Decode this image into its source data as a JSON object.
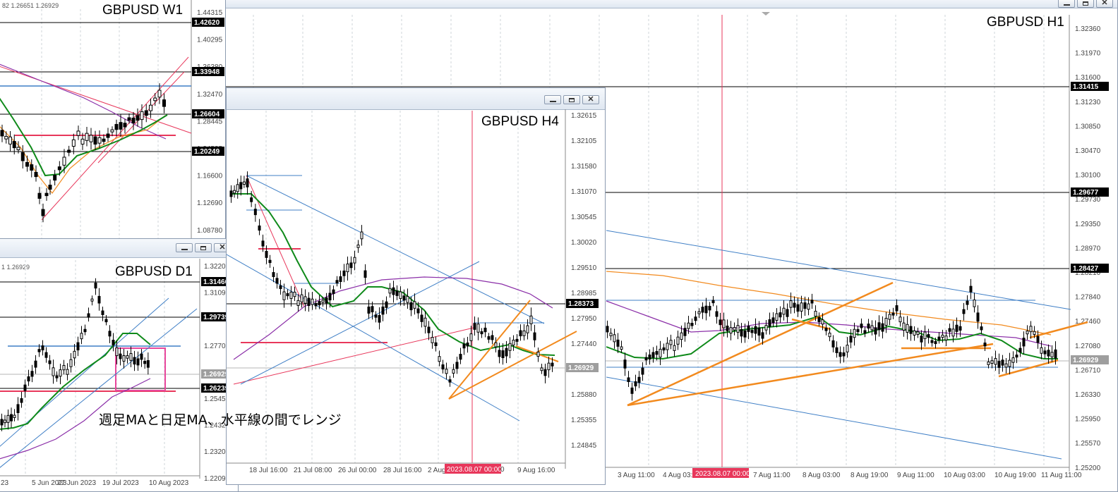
{
  "windows": {
    "h1": {
      "symbol_label": "GBPUSD H1",
      "price_scale": [
        "1.32360",
        "1.31970",
        "1.31600",
        "1.31230",
        "1.30850",
        "1.30470",
        "1.30100",
        "1.29730",
        "1.29350",
        "1.28970",
        "1.28210",
        "1.27840",
        "1.27460",
        "1.27080",
        "1.26710",
        "1.26330",
        "1.25950",
        "1.25570",
        "1.25200"
      ],
      "levels": [
        "1.31415",
        "1.29677",
        "1.28427",
        "1.26929"
      ],
      "time_axis": [
        "3 Aug 11:00",
        "4 Aug 03:00",
        "7 Aug 11:00",
        "8 Aug 03:00",
        "8 Aug 19:00",
        "9 Aug 11:00",
        "10 Aug 03:00",
        "10 Aug 19:00",
        "11 Aug 11:00"
      ],
      "time_marker": "2023.08.07 00:00"
    },
    "w1": {
      "symbol_label": "GBPUSD W1",
      "header_text": "82 1.26651 1.26929",
      "price_scale": [
        "1.44315",
        "1.40295",
        "1.36380",
        "1.32470",
        "1.28445",
        "1.24535",
        "1.16600",
        "1.12690",
        "1.08780"
      ],
      "levels": [
        "1.42620",
        "1.33948",
        "1.26604",
        "1.20249"
      ]
    },
    "d1": {
      "symbol_label": "GBPUSD D1",
      "header_text": "1 1.26929",
      "price_scale": [
        "1.32200",
        "1.31090",
        "1.28840",
        "1.27700",
        "1.26590",
        "1.25450",
        "1.24320",
        "1.23200",
        "1.22090"
      ],
      "levels": [
        "1.31466",
        "1.29739",
        "1.26929",
        "1.26239"
      ],
      "time_axis": [
        "23",
        "5 Jun 2023",
        "27 Jun 2023",
        "19 Jul 2023",
        "10 Aug 2023"
      ]
    },
    "h4": {
      "symbol_label": "GBPUSD H4",
      "price_scale": [
        "1.32615",
        "1.32105",
        "1.31580",
        "1.31070",
        "1.30545",
        "1.30020",
        "1.29510",
        "1.28985",
        "1.27950",
        "1.27440",
        "1.26390",
        "1.25880",
        "1.25355",
        "1.24845"
      ],
      "levels": [
        "1.28373",
        "1.26929"
      ],
      "time_axis": [
        "18 Jul 16:00",
        "21 Jul 08:00",
        "26 Jul 00:00",
        "28 Jul 16:00",
        "2 Aug",
        "9 Aug 16:00"
      ],
      "time_axis_partial": "0",
      "time_marker": "2023.08.07 00:00"
    }
  },
  "annotation": "週足MAと日足MA、水平線の間でレンジ",
  "colors": {
    "red_line": "#e8375b",
    "green_ma": "#0f8a1a",
    "purple_ma": "#8b2fa8",
    "orange_line": "#f28a1e",
    "blue_channel": "#3f7fc6",
    "pink_box": "#e8479c"
  }
}
